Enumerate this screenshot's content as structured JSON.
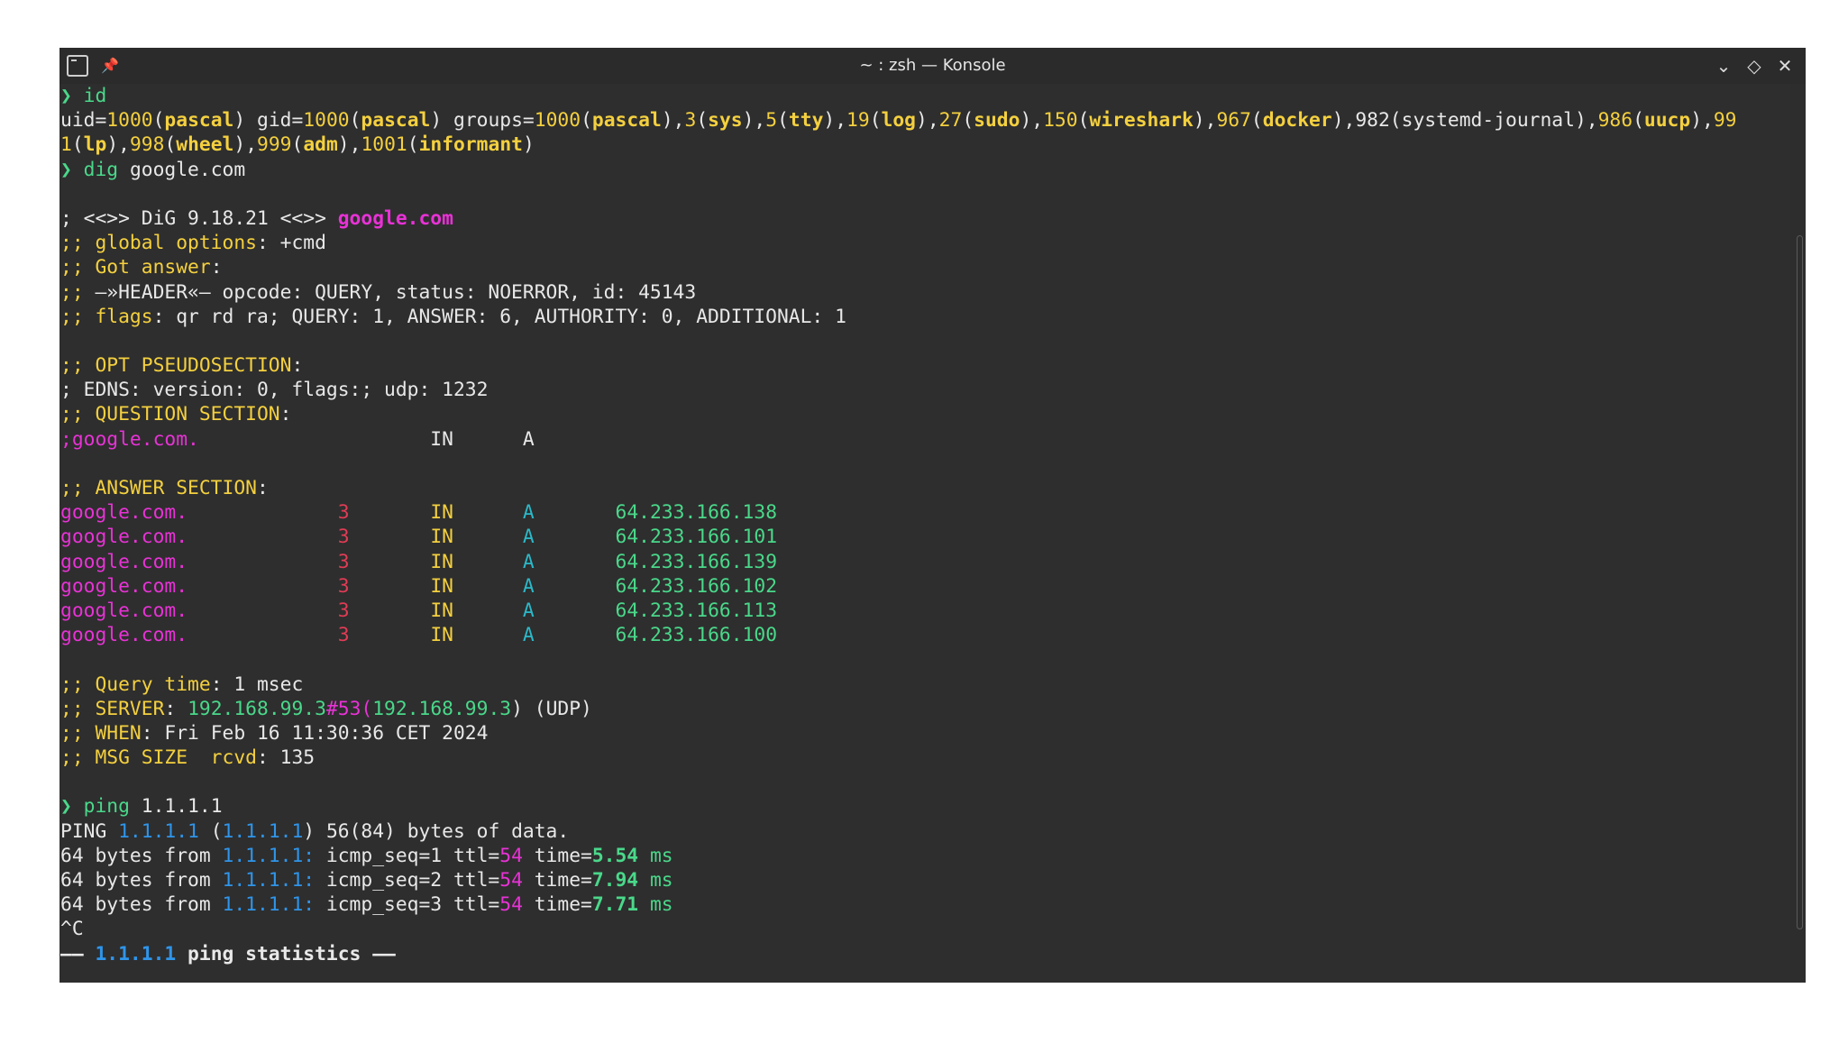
{
  "window": {
    "title": "~ : zsh — Konsole",
    "icons": {
      "app": "terminal-icon",
      "pin": "pin-icon",
      "minimize": "chevron-down-icon",
      "maximize": "diamond-icon",
      "close": "close-icon"
    }
  },
  "colors": {
    "foreground": "#e8e8e8",
    "yellow": "#f4d03f",
    "green": "#4ad88a",
    "magenta": "#e832d6",
    "blue": "#2f95ea",
    "cyan": "#2bb9c9",
    "red": "#e03c55",
    "background": "#2e2e2e"
  },
  "terminal": {
    "lines": [
      [
        {
          "t": "❯ ",
          "c": "green"
        },
        {
          "t": "id",
          "c": "green"
        }
      ],
      [
        {
          "t": "uid="
        },
        {
          "t": "1000",
          "c": "yellow"
        },
        {
          "t": "("
        },
        {
          "t": "pascal",
          "c": "yellow",
          "b": true
        },
        {
          "t": ") gid="
        },
        {
          "t": "1000",
          "c": "yellow"
        },
        {
          "t": "("
        },
        {
          "t": "pascal",
          "c": "yellow",
          "b": true
        },
        {
          "t": ") groups="
        },
        {
          "t": "1000",
          "c": "yellow"
        },
        {
          "t": "("
        },
        {
          "t": "pascal",
          "c": "yellow",
          "b": true
        },
        {
          "t": "),"
        },
        {
          "t": "3",
          "c": "yellow"
        },
        {
          "t": "("
        },
        {
          "t": "sys",
          "c": "yellow",
          "b": true
        },
        {
          "t": "),"
        },
        {
          "t": "5",
          "c": "yellow"
        },
        {
          "t": "("
        },
        {
          "t": "tty",
          "c": "yellow",
          "b": true
        },
        {
          "t": "),"
        },
        {
          "t": "19",
          "c": "yellow"
        },
        {
          "t": "("
        },
        {
          "t": "log",
          "c": "yellow",
          "b": true
        },
        {
          "t": "),"
        },
        {
          "t": "27",
          "c": "yellow"
        },
        {
          "t": "("
        },
        {
          "t": "sudo",
          "c": "yellow",
          "b": true
        },
        {
          "t": "),"
        },
        {
          "t": "150",
          "c": "yellow"
        },
        {
          "t": "("
        },
        {
          "t": "wireshark",
          "c": "yellow",
          "b": true
        },
        {
          "t": "),"
        },
        {
          "t": "967",
          "c": "yellow"
        },
        {
          "t": "("
        },
        {
          "t": "docker",
          "c": "yellow",
          "b": true
        },
        {
          "t": "),982(systemd-journal),"
        },
        {
          "t": "986",
          "c": "yellow"
        },
        {
          "t": "("
        },
        {
          "t": "uucp",
          "c": "yellow",
          "b": true
        },
        {
          "t": "),"
        },
        {
          "t": "99",
          "c": "yellow"
        }
      ],
      [
        {
          "t": "1",
          "c": "yellow"
        },
        {
          "t": "("
        },
        {
          "t": "lp",
          "c": "yellow",
          "b": true
        },
        {
          "t": "),"
        },
        {
          "t": "998",
          "c": "yellow"
        },
        {
          "t": "("
        },
        {
          "t": "wheel",
          "c": "yellow",
          "b": true
        },
        {
          "t": "),"
        },
        {
          "t": "999",
          "c": "yellow"
        },
        {
          "t": "("
        },
        {
          "t": "adm",
          "c": "yellow",
          "b": true
        },
        {
          "t": "),"
        },
        {
          "t": "1001",
          "c": "yellow"
        },
        {
          "t": "("
        },
        {
          "t": "informant",
          "c": "yellow",
          "b": true
        },
        {
          "t": ")"
        }
      ],
      [
        {
          "t": "❯ ",
          "c": "green"
        },
        {
          "t": "dig",
          "c": "green"
        },
        {
          "t": " google.com"
        }
      ],
      [],
      [
        {
          "t": "; <<>> DiG 9.18.21 <<>> "
        },
        {
          "t": "google.com",
          "c": "magenta",
          "b": true
        }
      ],
      [
        {
          "t": ";; global options",
          "c": "yellow"
        },
        {
          "t": ": +cmd"
        }
      ],
      [
        {
          "t": ";; Got answer",
          "c": "yellow"
        },
        {
          "t": ":"
        }
      ],
      [
        {
          "t": ";; ",
          "c": "yellow"
        },
        {
          "t": "—»HEADER«— opcode: QUERY, status: NOERROR, id: 45143"
        }
      ],
      [
        {
          "t": ";; flags",
          "c": "yellow"
        },
        {
          "t": ": qr rd ra; QUERY: 1, ANSWER: 6, AUTHORITY: 0, ADDITIONAL: 1"
        }
      ],
      [],
      [
        {
          "t": ";; OPT PSEUDOSECTION",
          "c": "yellow"
        },
        {
          "t": ":"
        }
      ],
      [
        {
          "t": "; EDNS: version: 0, flags:; udp: 1232"
        }
      ],
      [
        {
          "t": ";; QUESTION SECTION",
          "c": "yellow"
        },
        {
          "t": ":"
        }
      ],
      [
        {
          "t": ";google.com.",
          "c": "magenta"
        },
        {
          "t": "                    IN      A"
        }
      ],
      [],
      [
        {
          "t": ";; ANSWER SECTION",
          "c": "yellow"
        },
        {
          "t": ":"
        }
      ],
      [
        {
          "t": "google.com.",
          "c": "magenta"
        },
        {
          "t": "             "
        },
        {
          "t": "3",
          "c": "red"
        },
        {
          "t": "       "
        },
        {
          "t": "IN",
          "c": "yellow"
        },
        {
          "t": "      "
        },
        {
          "t": "A",
          "c": "cyan"
        },
        {
          "t": "       "
        },
        {
          "t": "64.233.166.138",
          "c": "green"
        }
      ],
      [
        {
          "t": "google.com.",
          "c": "magenta"
        },
        {
          "t": "             "
        },
        {
          "t": "3",
          "c": "red"
        },
        {
          "t": "       "
        },
        {
          "t": "IN",
          "c": "yellow"
        },
        {
          "t": "      "
        },
        {
          "t": "A",
          "c": "cyan"
        },
        {
          "t": "       "
        },
        {
          "t": "64.233.166.101",
          "c": "green"
        }
      ],
      [
        {
          "t": "google.com.",
          "c": "magenta"
        },
        {
          "t": "             "
        },
        {
          "t": "3",
          "c": "red"
        },
        {
          "t": "       "
        },
        {
          "t": "IN",
          "c": "yellow"
        },
        {
          "t": "      "
        },
        {
          "t": "A",
          "c": "cyan"
        },
        {
          "t": "       "
        },
        {
          "t": "64.233.166.139",
          "c": "green"
        }
      ],
      [
        {
          "t": "google.com.",
          "c": "magenta"
        },
        {
          "t": "             "
        },
        {
          "t": "3",
          "c": "red"
        },
        {
          "t": "       "
        },
        {
          "t": "IN",
          "c": "yellow"
        },
        {
          "t": "      "
        },
        {
          "t": "A",
          "c": "cyan"
        },
        {
          "t": "       "
        },
        {
          "t": "64.233.166.102",
          "c": "green"
        }
      ],
      [
        {
          "t": "google.com.",
          "c": "magenta"
        },
        {
          "t": "             "
        },
        {
          "t": "3",
          "c": "red"
        },
        {
          "t": "       "
        },
        {
          "t": "IN",
          "c": "yellow"
        },
        {
          "t": "      "
        },
        {
          "t": "A",
          "c": "cyan"
        },
        {
          "t": "       "
        },
        {
          "t": "64.233.166.113",
          "c": "green"
        }
      ],
      [
        {
          "t": "google.com.",
          "c": "magenta"
        },
        {
          "t": "             "
        },
        {
          "t": "3",
          "c": "red"
        },
        {
          "t": "       "
        },
        {
          "t": "IN",
          "c": "yellow"
        },
        {
          "t": "      "
        },
        {
          "t": "A",
          "c": "cyan"
        },
        {
          "t": "       "
        },
        {
          "t": "64.233.166.100",
          "c": "green"
        }
      ],
      [],
      [
        {
          "t": ";; Query time",
          "c": "yellow"
        },
        {
          "t": ": 1 msec"
        }
      ],
      [
        {
          "t": ";; SERVER",
          "c": "yellow"
        },
        {
          "t": ": "
        },
        {
          "t": "192.168.99.3",
          "c": "green"
        },
        {
          "t": "#53(",
          "c": "magenta"
        },
        {
          "t": "192.168.99.3",
          "c": "green"
        },
        {
          "t": ") (UDP)"
        }
      ],
      [
        {
          "t": ";; WHEN",
          "c": "yellow"
        },
        {
          "t": ": Fri Feb 16 11:30:36 CET 2024"
        }
      ],
      [
        {
          "t": ";; MSG SIZE  rcvd",
          "c": "yellow"
        },
        {
          "t": ": 135"
        }
      ],
      [],
      [
        {
          "t": "❯ ",
          "c": "green"
        },
        {
          "t": "ping",
          "c": "green"
        },
        {
          "t": " 1.1.1.1"
        }
      ],
      [
        {
          "t": "PING "
        },
        {
          "t": "1.1.1.1",
          "c": "blue"
        },
        {
          "t": " ("
        },
        {
          "t": "1.1.1.1",
          "c": "blue"
        },
        {
          "t": ") 56(84) bytes of data."
        }
      ],
      [
        {
          "t": "64 bytes from "
        },
        {
          "t": "1.1.1.1:",
          "c": "blue"
        },
        {
          "t": " icmp_seq=1 ttl="
        },
        {
          "t": "54",
          "c": "magenta"
        },
        {
          "t": " time="
        },
        {
          "t": "5.54",
          "c": "green",
          "b": true
        },
        {
          "t": " ms",
          "c": "green"
        }
      ],
      [
        {
          "t": "64 bytes from "
        },
        {
          "t": "1.1.1.1:",
          "c": "blue"
        },
        {
          "t": " icmp_seq=2 ttl="
        },
        {
          "t": "54",
          "c": "magenta"
        },
        {
          "t": " time="
        },
        {
          "t": "7.94",
          "c": "green",
          "b": true
        },
        {
          "t": " ms",
          "c": "green"
        }
      ],
      [
        {
          "t": "64 bytes from "
        },
        {
          "t": "1.1.1.1:",
          "c": "blue"
        },
        {
          "t": " icmp_seq=3 ttl="
        },
        {
          "t": "54",
          "c": "magenta"
        },
        {
          "t": " time="
        },
        {
          "t": "7.71",
          "c": "green",
          "b": true
        },
        {
          "t": " ms",
          "c": "green"
        }
      ],
      [
        {
          "t": "^C"
        }
      ],
      [
        {
          "t": "—— ",
          "b": true
        },
        {
          "t": "1.1.1.1",
          "c": "blue",
          "b": true
        },
        {
          "t": " ping statistics ——",
          "b": true
        }
      ]
    ]
  }
}
